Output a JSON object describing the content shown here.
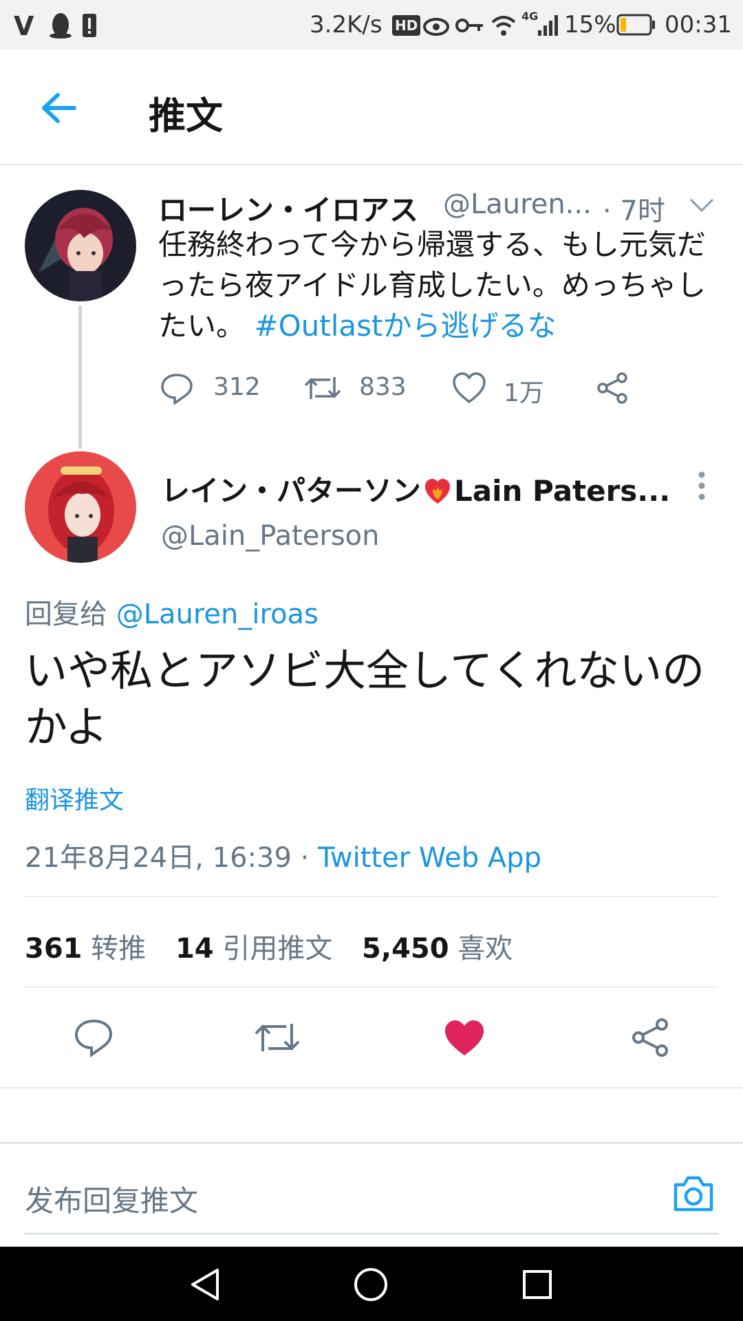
{
  "status_bar": {
    "left_icons": [
      "v-icon",
      "qq-penguin-icon",
      "alert-icon"
    ],
    "speed": "3.2K/s",
    "hd_badge": "HD",
    "network": "4G",
    "battery": "15%",
    "time": "00:31"
  },
  "header": {
    "title": "推文"
  },
  "parent_tweet": {
    "name": "ローレン・イロアス",
    "handle": "@Lauren...",
    "time": "· 7时",
    "text": "任務終わって今から帰還する、もし元気だったら夜アイドル育成したい。めっちゃしたい。",
    "hashtag": "#Outlastから逃げるな",
    "replies": "312",
    "retweets": "833",
    "likes": "1万"
  },
  "main_tweet": {
    "name": "レイン・パターソン",
    "name_suffix": "Lain Paters...",
    "handle": "@Lain_Paterson",
    "reply_prefix": "回复给",
    "reply_to": "@Lauren_iroas",
    "text": "いや私とアソビ大全してくれないのかよ",
    "translate": "翻译推文",
    "datetime": "21年8月24日, 16:39",
    "sep": "·",
    "source": "Twitter Web App"
  },
  "stats": [
    {
      "count": "361",
      "label": "转推"
    },
    {
      "count": "14",
      "label": "引用推文"
    },
    {
      "count": "5,450",
      "label": "喜欢"
    }
  ],
  "reply_box": {
    "placeholder": "发布回复推文"
  },
  "colors": {
    "accent": "#1da1f2",
    "like": "#e0245e",
    "muted": "#657786"
  }
}
